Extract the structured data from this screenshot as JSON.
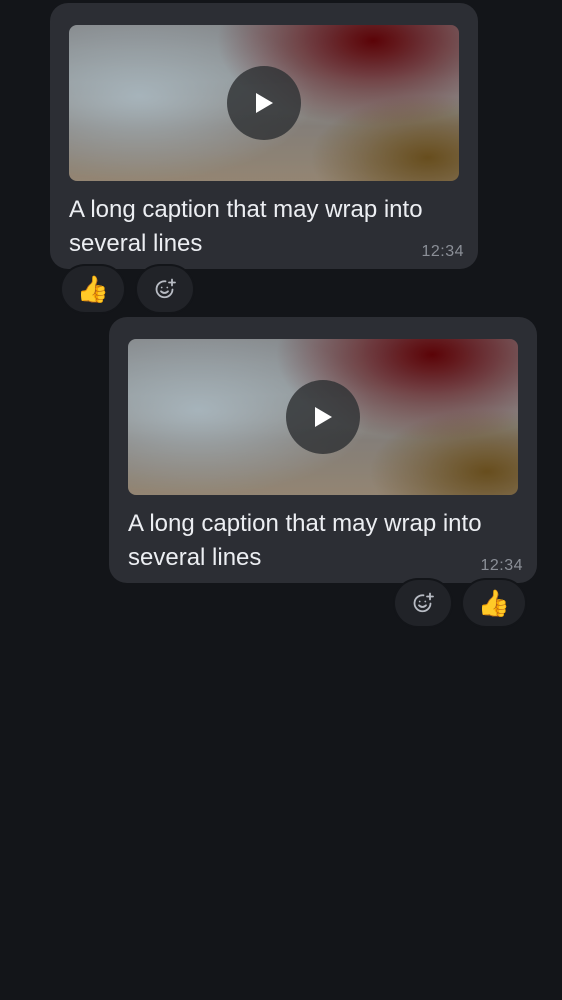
{
  "messages": [
    {
      "caption": "A long caption that may wrap into several lines",
      "time": "12:34",
      "reaction_emoji": "👍",
      "add_reaction_icon": "add-reaction-icon",
      "play_icon": "play-icon"
    },
    {
      "caption": "A long caption that may wrap into several lines",
      "time": "12:34",
      "reaction_emoji": "👍",
      "add_reaction_icon": "add-reaction-icon",
      "play_icon": "play-icon"
    }
  ],
  "colors": {
    "background": "#131519",
    "bubble": "#2c2e34",
    "reaction_pill": "#212328",
    "timestamp": "#8b8f97"
  }
}
